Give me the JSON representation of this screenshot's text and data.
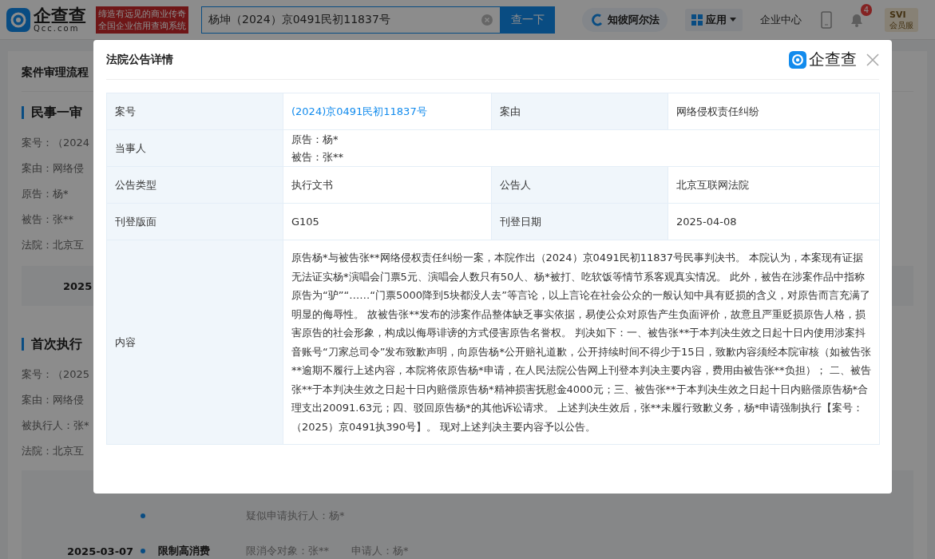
{
  "header": {
    "logo_text": "企查查",
    "logo_domain": "Qcc.com",
    "slogan": [
      "缔造有远见的商业传奇",
      "全国企业信用查询系统"
    ],
    "search": {
      "value": "杨坤（2024）京0491民初11837号"
    },
    "search_button": "查一下",
    "alpha_button": "知彼阿尔法",
    "apps_button": "应用",
    "enterprise_center": "企业中心",
    "notification_count": "4",
    "vip": {
      "label": "SVI",
      "sublabel": "会员服"
    }
  },
  "page": {
    "section_title": "案件审理流程",
    "sections": [
      {
        "title": "民事一审",
        "fields": [
          "案号：（2024",
          "案由：网络侵",
          "原告：杨*",
          "被告：张**",
          "法院：北京互"
        ],
        "dates": [
          "2025"
        ]
      },
      {
        "title": "首次执行",
        "fields": [
          "案号：（2025",
          "案由：网络侵",
          "被执行人：张*",
          "法院：北京互"
        ]
      }
    ],
    "timeline": [
      {
        "details": [
          "疑似申请执行人：杨*"
        ]
      },
      {
        "date": "2025-03-07",
        "title": "限制高消费",
        "details": [
          "限消令对象：张**",
          "申请人：杨*"
        ]
      }
    ]
  },
  "modal": {
    "title": "法院公告详情",
    "brand": "企查查",
    "rows": [
      [
        {
          "label": "案号",
          "kind": "link",
          "value": "(2024)京0491民初11837号"
        },
        {
          "label": "案由",
          "kind": "text",
          "value": "网络侵权责任纠纷"
        }
      ],
      [
        {
          "label": "当事人",
          "kind": "lines",
          "lines": [
            "原告：杨*",
            "被告：张**"
          ]
        }
      ],
      [
        {
          "label": "公告类型",
          "kind": "text",
          "value": "执行文书"
        },
        {
          "label": "公告人",
          "kind": "text",
          "value": "北京互联网法院"
        }
      ],
      [
        {
          "label": "刊登版面",
          "kind": "text",
          "value": "G105"
        },
        {
          "label": "刊登日期",
          "kind": "text",
          "value": "2025-04-08"
        }
      ],
      [
        {
          "label": "内容",
          "kind": "paragraph",
          "value": "原告杨*与被告张**网络侵权责任纠纷一案，本院作出（2024）京0491民初11837号民事判决书。 本院认为，本案现有证据无法证实杨*演唱会门票5元、演唱会人数只有50人、杨*被打、吃软饭等情节系客观真实情况。 此外，被告在涉案作品中指称原告为“驴”“……“门票5000降到5块都没人去”等言论，以上言论在社会公众的一般认知中具有贬损的含义，对原告而言充满了明显的侮辱性。 故被告张**发布的涉案作品整体缺乏事实依据，易使公众对原告产生负面评价，故意且严重贬损原告人格，损害原告的社会形象，构成以侮辱诽谤的方式侵害原告名誉权。 判决如下：一、被告张**于本判决生效之日起十日内使用涉案抖音账号“刀家总司令”发布致歉声明，向原告杨*公开赔礼道歉，公开持续时间不得少于15日，致歉内容须经本院审核（如被告张**逾期不履行上述内容，本院将依原告杨*申请，在人民法院公告网上刊登本判决主要内容，费用由被告张**负担）； 二、被告张**于本判决生效之日起十日内赔偿原告杨*精神损害抚慰金4000元；三、被告张**于本判决生效之日起十日内赔偿原告杨*合理支出20091.63元；四、驳回原告杨*的其他诉讼请求。 上述判决生效后，张**未履行致歉义务，杨*申请强制执行【案号：（2025）京0491执390号】。 现对上述判决主要内容予以公告。"
        }
      ]
    ]
  }
}
